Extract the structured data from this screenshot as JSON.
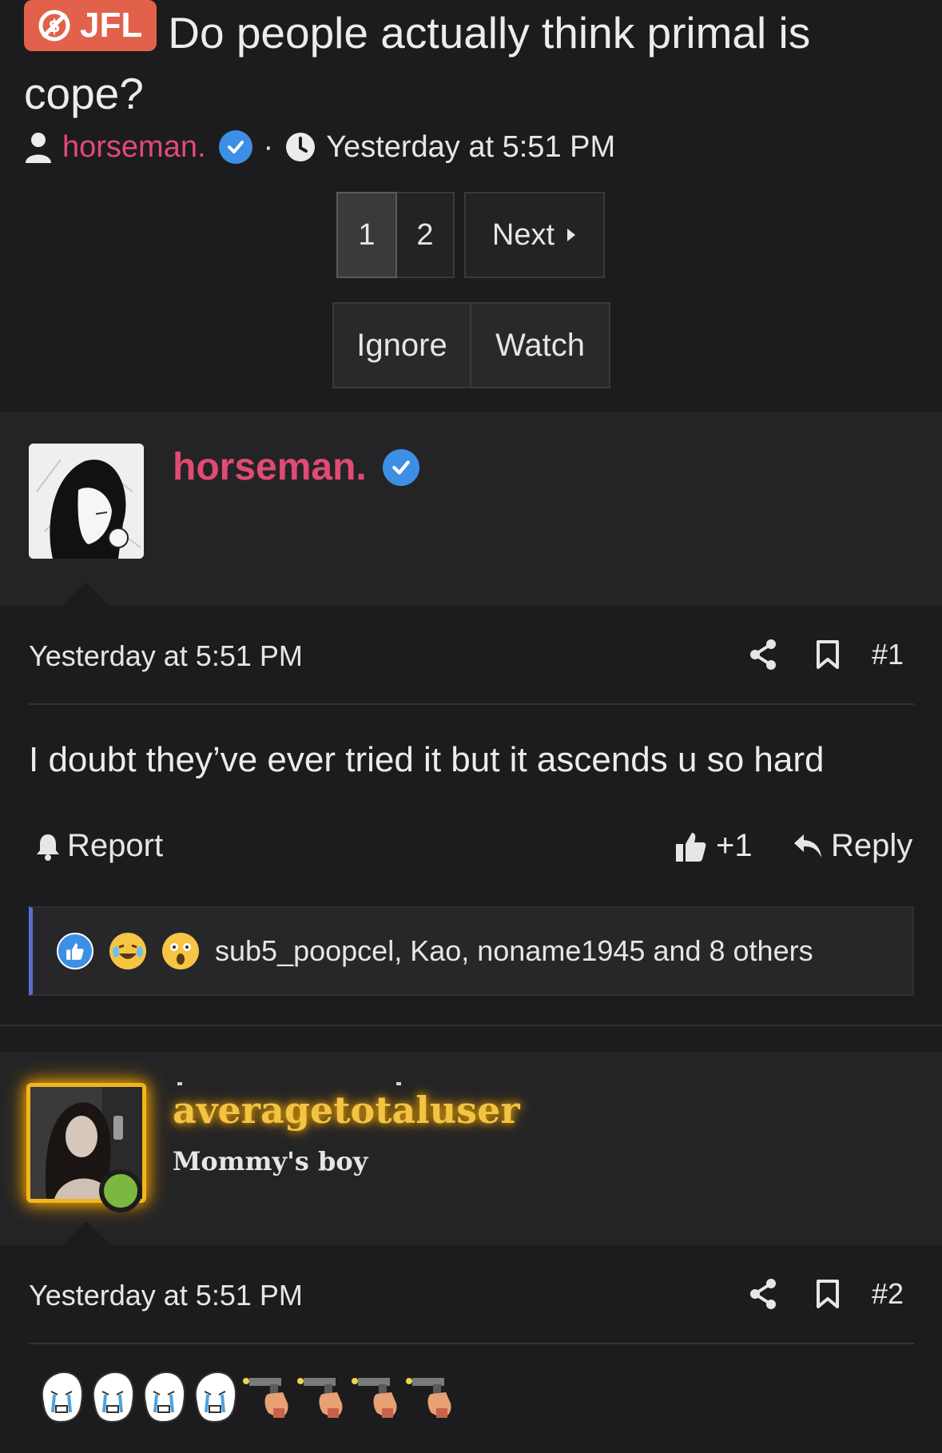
{
  "thread": {
    "prefix": "JFL",
    "title": "Do people actually think primal is cope?",
    "author": "horseman.",
    "separator": "·",
    "time": "Yesterday at 5:51 PM"
  },
  "pagination": {
    "pages": [
      "1",
      "2"
    ],
    "current": "1",
    "next_label": "Next"
  },
  "thread_actions": {
    "ignore_label": "Ignore",
    "watch_label": "Watch"
  },
  "posts": [
    {
      "author": "horseman.",
      "date": "Yesterday at 5:51 PM",
      "number": "#1",
      "message": "I doubt they’ve ever tried it but it ascends u so hard",
      "report_label": "Report",
      "like_label": "+1",
      "reply_label": "Reply",
      "reactions_text": "sub5_poopcel, Kao, noname1945 and 8 others"
    },
    {
      "author": "averagetotaluser",
      "user_title": "Mommy's boy",
      "date": "Yesterday at 5:51 PM",
      "number": "#2"
    }
  ],
  "colors": {
    "background": "#1c1c1e",
    "username_accent": "#e14a74",
    "prefix_badge": "#e2614a",
    "verified_badge": "#3d8fe6",
    "fancy_username": "#f3c443",
    "online_dot": "#7cb83f",
    "reaction_bar": "#5a6ed1"
  },
  "icons": {
    "prefix_icon": "no-sugar-icon",
    "author_icon": "user-icon",
    "time_icon": "clock-icon",
    "verified_icon": "verified-check-icon",
    "share_icon": "share-icon",
    "bookmark_icon": "bookmark-icon",
    "report_icon": "bell-icon",
    "like_icon": "thumbs-up-icon",
    "reply_icon": "reply-arrow-icon",
    "reaction_icons": [
      "like-reaction-icon",
      "crying-laughing-reaction-icon",
      "shocked-reaction-icon"
    ],
    "message_emojis": [
      "crying-wojak-emoji",
      "crying-wojak-emoji",
      "crying-wojak-emoji",
      "crying-wojak-emoji",
      "pistol-hand-emoji",
      "pistol-hand-emoji",
      "pistol-hand-emoji",
      "pistol-hand-emoji"
    ]
  }
}
